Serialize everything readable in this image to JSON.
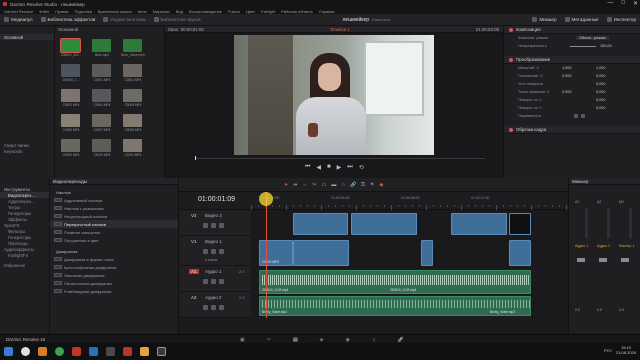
{
  "window": {
    "title": "DaVinci Resolve Studio - лешмейкер",
    "min": "—",
    "max": "□",
    "close": "✕"
  },
  "menu": [
    "DaVinci Resolve",
    "Файл",
    "Правка",
    "Подгонка",
    "Временная шкала",
    "Клип",
    "Маркеры",
    "Вид",
    "Воспроизведение",
    "Fusion",
    "Цвет",
    "Fairlight",
    "Рабочая область",
    "Справка"
  ],
  "toolbar": {
    "media_pool": "Медиапул",
    "effects_library": "Библиотека эффектов",
    "edit_index": "Индекс монтажа",
    "sound_library": "Библиотека звуков",
    "project_name": "лешмейкер",
    "edited": "Изменено",
    "mixer": "Микшер",
    "metadata": "Метаданные",
    "inspector": "Инспектор"
  },
  "media_pool": {
    "sidebar_title": "Основной",
    "smart_bins_label": "Смарт-папки",
    "keywords": "Keywords",
    "clips": [
      {
        "name": "200810_112...",
        "color": "#2f8a3a"
      },
      {
        "name": "Bruh.mp3",
        "color": "#2f7a3a"
      },
      {
        "name": "Bruh_Voice.mp3",
        "color": "#2f7a3a"
      },
      {
        "name": "200810_1...",
        "color": "#4a5560"
      },
      {
        "name": "C0001.MP4",
        "color": "#5b5b5b"
      },
      {
        "name": "C0002.MP4",
        "color": "#6d6560"
      },
      {
        "name": "C0003.MP4",
        "color": "#7a7570"
      },
      {
        "name": "C0004.MP4",
        "color": "#55585c"
      },
      {
        "name": "C0005.MP4",
        "color": "#6e6a64"
      },
      {
        "name": "C0006.MP4",
        "color": "#8a8075"
      },
      {
        "name": "C0007.MP4",
        "color": "#6b6862"
      },
      {
        "name": "C0008.MP4",
        "color": "#827a6f"
      },
      {
        "name": "C0009.MP4",
        "color": "#6a6660"
      },
      {
        "name": "C0010.MP4",
        "color": "#5e5c58"
      },
      {
        "name": "C0011.MP4",
        "color": "#7d776e"
      }
    ]
  },
  "viewer": {
    "label": "Окно",
    "timecode_left": "00:00:51:00",
    "timeline_name": "Timeline 1",
    "timecode_right": "01:00:03:09",
    "zoom": "67%"
  },
  "inspector": {
    "composite": "Композиция",
    "composite_mode_label": "Композит. режим",
    "composite_mode_value": "Обычн...режим",
    "opacity_label": "Непрозрачность",
    "opacity_value": "100,00",
    "transform": "Преобразование",
    "zoom_label": "Масштаб: Х",
    "zoom_x": "1,000",
    "zoom_y": "1,000",
    "position_label": "Положение: Х",
    "position_x": "0,000",
    "position_y": "0,000",
    "rotation_label": "Угол поворота",
    "rotation_value": "0,000",
    "anchor_label": "Точка привязки: Х",
    "anchor_x": "0,000",
    "anchor_y": "0,000",
    "pitch_label": "Поворот по Х",
    "pitch_value": "0,000",
    "yaw_label": "Поворот по Y",
    "yaw_value": "0,000",
    "flip_label": "Перевернуть",
    "crop": "Обрезка кадра"
  },
  "effects": {
    "toolbox": "Инструменты",
    "video_transitions": "Видеоперех...",
    "audio_transitions": "Аудиоперех...",
    "titles": "Титры",
    "generators": "Генераторы",
    "effects": "Эффекты",
    "openfx": "OpenFX",
    "filters": "Фильтры",
    "generators2": "Генераторы",
    "transitions": "Переходы",
    "audiofx": "Аудиоэффекты",
    "fairlightfx": "FairlightFX",
    "favorites": "Избранное",
    "group_header": "Видеопереходы",
    "dissolve_label": "Наплыв",
    "dissolve_items": [
      "Аддитивный наплыв",
      "Наплыв с размытием",
      "Неоднородный наплыв",
      "Перекрестный наплыв",
      "Плавное смещение",
      "Погружение в цвет"
    ],
    "iris_label": "Диафрагма",
    "iris_items": [
      "Диафрагма в форме глаза",
      "Крестообразная диафрагма",
      "Овальная диафрагма",
      "Пятиугольная диафрагма",
      "Ромбовидная диафрагма"
    ]
  },
  "timeline": {
    "timecode": "01:00:01:09",
    "ruler": [
      "01:00:00:00",
      "01:00:04:00",
      "01:00:08:00",
      "01:00:12:00"
    ],
    "tracks": {
      "v2": {
        "id": "V2",
        "name": "Видео 2"
      },
      "v1": {
        "id": "V1",
        "name": "Видео 1",
        "count": "3 клипа"
      },
      "a1": {
        "id": "A1",
        "name": "Аудио 1",
        "level": "2.0"
      },
      "a2": {
        "id": "A2",
        "name": "Аудио 2",
        "level": "2.0"
      }
    },
    "clips": {
      "v1a": "C0-XX.MP4",
      "a1": "200810_1122.mp4",
      "a1b": "200810_1122.mp4",
      "a2": "Bruhy_Voice.mp3",
      "a2b": "Bruhy_Voice.mp3"
    }
  },
  "mixer": {
    "title": "Микшер",
    "channels": [
      "A1",
      "A2",
      "M1"
    ],
    "names": [
      "Аудио 1",
      "Аудио 2",
      "Мастер 1"
    ],
    "db": [
      "0.0",
      "0.0",
      "0.0"
    ]
  },
  "pagebar": {
    "app_label": "DaVinci Resolve 16"
  },
  "taskbar": {
    "lang": "РУС",
    "time": "15:10",
    "date": "23.08.2020"
  },
  "colors": {
    "accent": "#c0392b",
    "video_clip": "#3f6f99",
    "audio_clip": "#2e6b4f",
    "playhead": "#e74c3c"
  }
}
